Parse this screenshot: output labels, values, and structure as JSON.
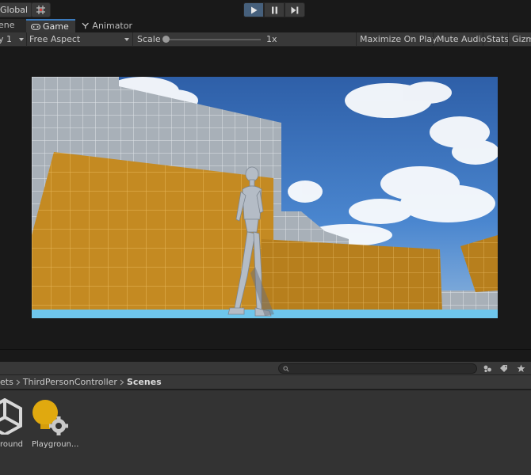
{
  "toolbar": {
    "global_label": "Global",
    "grid_icon": "grid-snap-icon",
    "play_icon": "play-icon",
    "pause_icon": "pause-icon",
    "step_icon": "step-icon",
    "play_active_color": "#46607c"
  },
  "tabs": [
    {
      "label": "ene",
      "icon": "scene-icon"
    },
    {
      "label": "Game",
      "icon": "game-controller-icon",
      "active": true
    },
    {
      "label": "Animator",
      "icon": "animator-icon"
    }
  ],
  "game_controls": {
    "display": "y 1",
    "aspect": "Free Aspect",
    "scale_label": "Scale",
    "scale_value": "1x",
    "maximize": "Maximize On Play",
    "mute": "Mute Audio",
    "stats": "Stats",
    "gizmos": "Gizm"
  },
  "project": {
    "search_placeholder": "",
    "breadcrumb": [
      "ets",
      "ThirdPersonController",
      "Scenes"
    ],
    "assets": [
      {
        "name": "round",
        "icon": "unity-scene-icon"
      },
      {
        "name": "Playgroun...",
        "icon": "lighting-settings-icon"
      }
    ]
  },
  "colors": {
    "accent_tab": "#3a79bb",
    "wall_orange": "#c48a22",
    "sky_top": "#2e5fa8"
  }
}
